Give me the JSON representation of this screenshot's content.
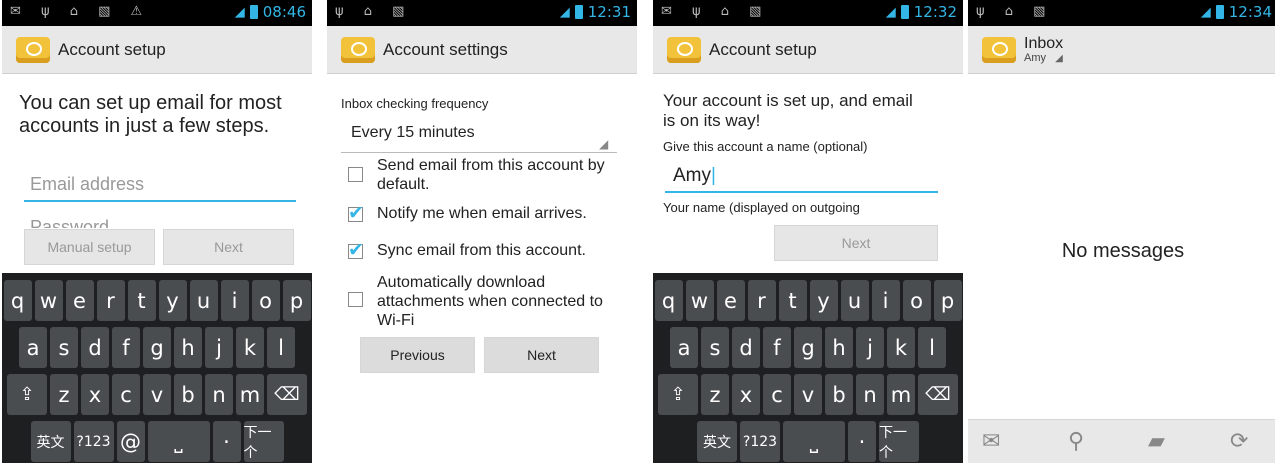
{
  "screens": [
    {
      "status": {
        "left_icons": "✉ ψ ⌂ ▧ ⚠",
        "time": "08:46"
      },
      "title": "Account setup",
      "heading": "You can set up email for most accounts in just a few steps.",
      "email_placeholder": "Email address",
      "password_placeholder": "Password",
      "manual_label": "Manual setup",
      "next_label": "Next"
    },
    {
      "status": {
        "left_icons": "ψ ⌂ ▧",
        "time": "12:31"
      },
      "title": "Account settings",
      "freq_label": "Inbox checking frequency",
      "freq_value": "Every 15 minutes",
      "opt1": "Send email from this account by default.",
      "opt2": "Notify me when email arrives.",
      "opt3": "Sync email from this account.",
      "opt4": "Automatically download attachments when connected to Wi-Fi",
      "prev_label": "Previous",
      "next_label": "Next"
    },
    {
      "status": {
        "left_icons": "✉ ψ ⌂ ▧",
        "time": "12:32"
      },
      "title": "Account setup",
      "heading": "Your account is set up, and email is on its way!",
      "name_label": "Give this account a name (optional)",
      "name_value": "Amy",
      "yourname_label": "Your name (displayed on outgoing",
      "next_label": "Next"
    },
    {
      "status": {
        "left_icons": "ψ ⌂ ▧",
        "time": "12:34"
      },
      "title": "Inbox",
      "account": "Amy",
      "empty": "No messages"
    }
  ],
  "keyboard": {
    "row1": [
      "q",
      "w",
      "e",
      "r",
      "t",
      "y",
      "u",
      "i",
      "o",
      "p"
    ],
    "row2": [
      "a",
      "s",
      "d",
      "f",
      "g",
      "h",
      "j",
      "k",
      "l"
    ],
    "row3": [
      "⇪",
      "z",
      "x",
      "c",
      "v",
      "b",
      "n",
      "m",
      "⌫"
    ],
    "row4_a": [
      "英文",
      "?123",
      "@",
      "␣",
      "·",
      "下一个"
    ],
    "row4_b": [
      "英文",
      "?123",
      "␣",
      "·",
      "下一个"
    ]
  },
  "colors": {
    "accent": "#33b5e5",
    "keyboard_bg": "#1d1f21",
    "key": "#4a4d50"
  }
}
